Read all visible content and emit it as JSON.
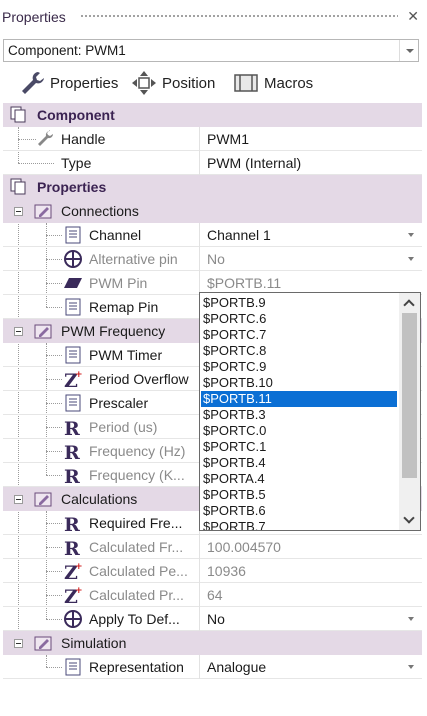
{
  "panel": {
    "title": "Properties"
  },
  "component_select": {
    "value": "Component: PWM1"
  },
  "toolbar": {
    "properties": "Properties",
    "position": "Position",
    "macros": "Macros"
  },
  "sections": {
    "component": "Component",
    "properties": "Properties",
    "connections": "Connections",
    "pwm_frequency": "PWM Frequency",
    "calculations": "Calculations",
    "simulation": "Simulation"
  },
  "rows": {
    "handle": {
      "name": "Handle",
      "value": "PWM1"
    },
    "type": {
      "name": "Type",
      "value": "PWM (Internal)"
    },
    "channel": {
      "name": "Channel",
      "value": "Channel 1"
    },
    "alt_pin": {
      "name": "Alternative pin",
      "value": "No"
    },
    "pwm_pin": {
      "name": "PWM Pin",
      "value": "$PORTB.11"
    },
    "remap_pin": {
      "name": "Remap Pin"
    },
    "pwm_timer": {
      "name": "PWM Timer"
    },
    "period_overflow": {
      "name": "Period Overflow"
    },
    "prescaler": {
      "name": "Prescaler"
    },
    "period_us": {
      "name": "Period (us)"
    },
    "frequency_hz": {
      "name": "Frequency (Hz)"
    },
    "frequency_k": {
      "name": "Frequency (K..."
    },
    "required_freq": {
      "name": "Required Fre..."
    },
    "calc_freq": {
      "name": "Calculated Fr...",
      "value": "100.004570"
    },
    "calc_period": {
      "name": "Calculated Pe...",
      "value": "10936"
    },
    "calc_prescaler": {
      "name": "Calculated Pr...",
      "value": "64"
    },
    "apply_default": {
      "name": "Apply To Def...",
      "value": "No"
    },
    "representation": {
      "name": "Representation",
      "value": "Analogue"
    }
  },
  "remap_dropdown": {
    "items": [
      "$PORTB.9",
      "$PORTC.6",
      "$PORTC.7",
      "$PORTC.8",
      "$PORTC.9",
      "$PORTB.10",
      "$PORTB.11",
      "$PORTB.3",
      "$PORTC.0",
      "$PORTC.1",
      "$PORTB.4",
      "$PORTA.4",
      "$PORTB.5",
      "$PORTB.6",
      "$PORTB.7"
    ],
    "selected": "$PORTB.11",
    "scroll_position": 0.0,
    "visible_fraction": 0.84
  },
  "colors": {
    "category_bg": "#e4d9e6",
    "category_text": "#3b2352",
    "selection": "#0b6fd4"
  }
}
